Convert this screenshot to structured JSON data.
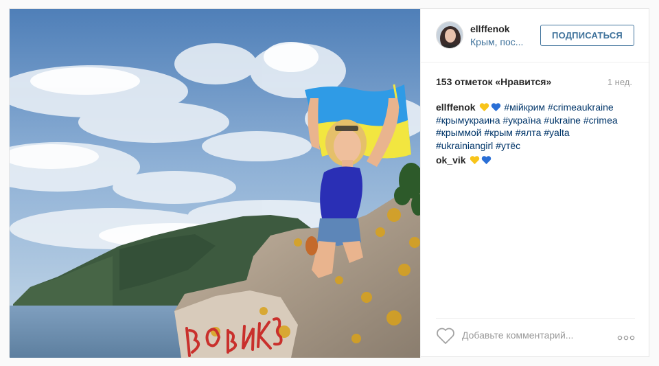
{
  "header": {
    "username": "ellffenok",
    "location": "Крым, пос...",
    "follow_label": "ПОДПИСАТЬСЯ"
  },
  "stats": {
    "likes": "153 отметок «Нравится»",
    "time_ago": "1 нед."
  },
  "caption": {
    "username": "ellffenok",
    "emojis": [
      "yellow-heart",
      "blue-heart"
    ],
    "hashtags": [
      "#мійкрим",
      "#crimeaukraine",
      "#крымукраина",
      "#україна",
      "#ukraine",
      "#crimea",
      "#крыммой",
      "#крым",
      "#ялта",
      "#yalta",
      "#ukrainiangirl",
      "#утёс"
    ]
  },
  "comments": [
    {
      "username": "ok_vik",
      "emojis": [
        "yellow-heart",
        "blue-heart"
      ]
    }
  ],
  "comment_box": {
    "placeholder": "Добавьте комментарий..."
  },
  "colors": {
    "link": "#3f729b",
    "hashtag": "#003569",
    "yellow_heart": "#f8c41a",
    "blue_heart": "#2a6fd6",
    "flag_blue": "#2f9be6",
    "flag_yellow": "#f2e640"
  },
  "icons": [
    "heart-icon",
    "more-options-icon"
  ]
}
